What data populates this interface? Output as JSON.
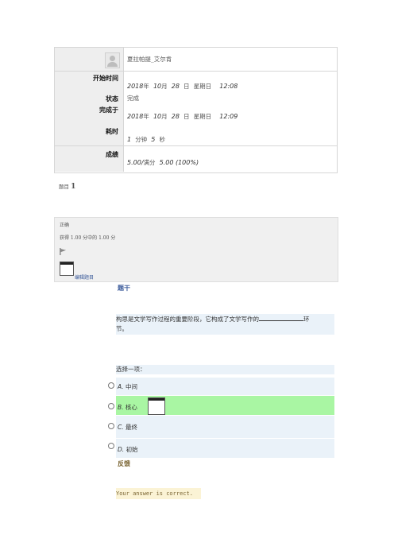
{
  "summary": {
    "user_name": "夏拉帕提_艾尔肯",
    "start_label": "开始时间",
    "start_date": "2018",
    "start_month": "10",
    "start_day": "28",
    "start_time": "12:08",
    "status_label": "状态",
    "status_value": "完成",
    "finish_label": "完成于",
    "finish_date": "2018",
    "finish_month": "10",
    "finish_day": "28",
    "finish_time": "12:09",
    "duration_label": "耗时",
    "duration_min": "1",
    "duration_sec": "5",
    "grade_label": "成绩",
    "grade_value": "5.00/",
    "grade_full_label": "满分",
    "grade_full": "5.00 (100%)",
    "unit_year": "年",
    "unit_month": "月",
    "unit_day": "日",
    "unit_weekday": "星期日",
    "unit_minute": "分钟",
    "unit_second": "秒"
  },
  "question": {
    "number_prefix": "题目",
    "number": "1",
    "status": "正确",
    "mark": "获得 1.00 分中的 1.00 分",
    "edit_label": "编辑题目",
    "stem_label": "题干",
    "text_before": "构思是文学写作过程的重要阶段，它构成了文学写作的",
    "text_after": "环",
    "text_line2": "节。",
    "select_prompt": "选择一项：",
    "options": [
      {
        "letter": "A.",
        "text": "中间"
      },
      {
        "letter": "B.",
        "text": "核心"
      },
      {
        "letter": "C.",
        "text": "最终"
      },
      {
        "letter": "D.",
        "text": "初始"
      }
    ],
    "selected_option": "B",
    "feedback_label": "反馈",
    "feedback_text": "Your answer is correct."
  },
  "colors": {
    "correct_bg": "#a9f6a3",
    "question_bg": "#eaf2f9",
    "feedback_bg": "#fbf3d5"
  }
}
